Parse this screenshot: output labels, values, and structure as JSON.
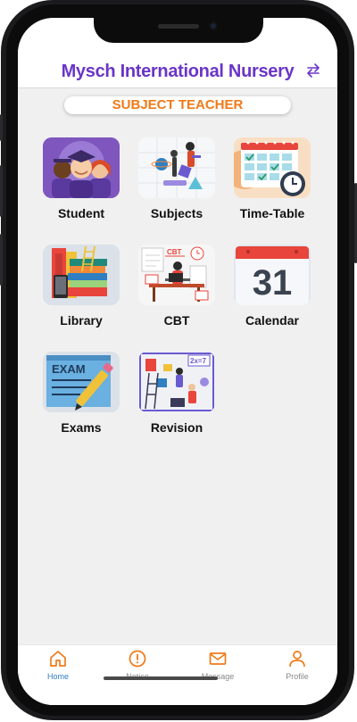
{
  "header": {
    "title": "Mysch International Nursery",
    "switch_icon": "swap-arrows-icon"
  },
  "role": {
    "label": "SUBJECT TEACHER"
  },
  "tiles": [
    {
      "label": "Student",
      "icon": "students-icon"
    },
    {
      "label": "Subjects",
      "icon": "subjects-icon"
    },
    {
      "label": "Time-Table",
      "icon": "timetable-icon"
    },
    {
      "label": "Library",
      "icon": "library-icon"
    },
    {
      "label": "CBT",
      "icon": "cbt-icon"
    },
    {
      "label": "Calendar",
      "icon": "calendar-icon"
    },
    {
      "label": "Exams",
      "icon": "exams-icon"
    },
    {
      "label": "Revision",
      "icon": "revision-icon"
    }
  ],
  "illustration_text": {
    "cbt": "CBT",
    "calendar_day": "31",
    "exam": "EXAM",
    "math": "2x=7"
  },
  "tabbar": {
    "items": [
      {
        "label": "Home",
        "icon": "home-icon",
        "active": true
      },
      {
        "label": "Notice",
        "icon": "alert-circle-icon",
        "active": false
      },
      {
        "label": "Message",
        "icon": "mail-icon",
        "active": false
      },
      {
        "label": "Profile",
        "icon": "user-icon",
        "active": false
      }
    ],
    "active_color": "#f07a18",
    "inactive_color": "#8a8a8a"
  },
  "colors": {
    "title": "#6a35c8",
    "accent": "#f07a18",
    "background": "#f0f0f0"
  }
}
